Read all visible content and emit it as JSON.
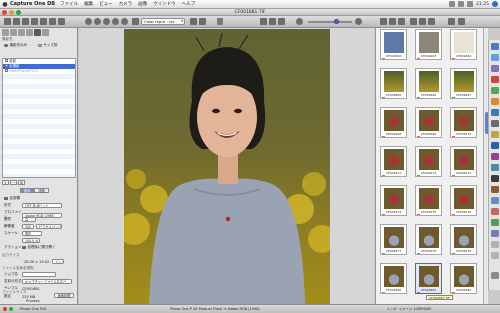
{
  "menubar": {
    "app_name": "Capture One DB",
    "items": [
      "ファイル",
      "編集",
      "ビュー",
      "カメラ",
      "画像",
      "ウインドウ",
      "ヘルプ"
    ],
    "clock": "21:25"
  },
  "window": {
    "title": "CF001681.TIF"
  },
  "toolbar": {
    "color_profile": "Color repro - rec"
  },
  "left_panel": {
    "section_title": "撮影先",
    "radio_options": [
      "撮影先のみ",
      "サイズ別"
    ],
    "albums": [
      {
        "label": "名前",
        "selected": false
      },
      {
        "label": "全撮影",
        "selected": true
      },
      {
        "label": "OpenPhoneFS2S",
        "selected": false
      }
    ],
    "list_buttons": [
      "+",
      "−",
      "⚙"
    ],
    "sub_tabs": [
      "基本",
      "詳細"
    ],
    "use_label": "名前欄",
    "form": [
      {
        "label": "形式",
        "value": "TIFF 非-8ビット"
      },
      {
        "label": "プロファイル",
        "value": "Adobe RGB (1998)"
      },
      {
        "label": "画質",
        "value": "高"
      },
      {
        "label": "解像度",
        "value": "300",
        "unit": "ピクセル/インチ"
      },
      {
        "label": "スケール",
        "value": "固定"
      }
    ],
    "scale_value": "100.0 %",
    "action_label": "アクション",
    "action_value": "処理後に開き開く",
    "output_section": "出力サイズ",
    "output_size": "28.39 × 19.02",
    "output_unit": "インチ",
    "name_section": "ファイル名命名規則",
    "job_label": "ジョブ名",
    "job_value": "",
    "name_format_label": "名前の形式",
    "name_format_value": "キャプチャーファイル名など",
    "sample_label": "サンプル",
    "sample_value": "CF001681",
    "file_section": "ファイルサイズ",
    "size_label": "推定",
    "size_value": "225 MB",
    "sort_button": "画像処理",
    "process_label": "Process"
  },
  "browser": {
    "thumbnails": [
      "CF001662",
      "CF001663",
      "CF001664",
      "CF001665",
      "CF001666",
      "CF001667",
      "CF001668",
      "CF001669",
      "CF001670",
      "CF001671",
      "CF001672",
      "CF001673",
      "CF001674",
      "CF001675",
      "CF001676",
      "CF001677",
      "CF001678",
      "CF001679",
      "CF001680",
      "CF001681",
      "CF001682"
    ],
    "selected_index": 19,
    "tooltip": "CF001681.TIF"
  },
  "statusbar": {
    "left": "Phase One P45",
    "center": "Phase One P 45 Product Flash ➜ Adobe RGB (1998)",
    "right": "1 / 47 イメージ 100PHASE"
  },
  "colors": {
    "accent": "#3d6dd3",
    "traffic_close": "#e0443e",
    "traffic_min": "#dea123",
    "traffic_max": "#1aab29"
  }
}
